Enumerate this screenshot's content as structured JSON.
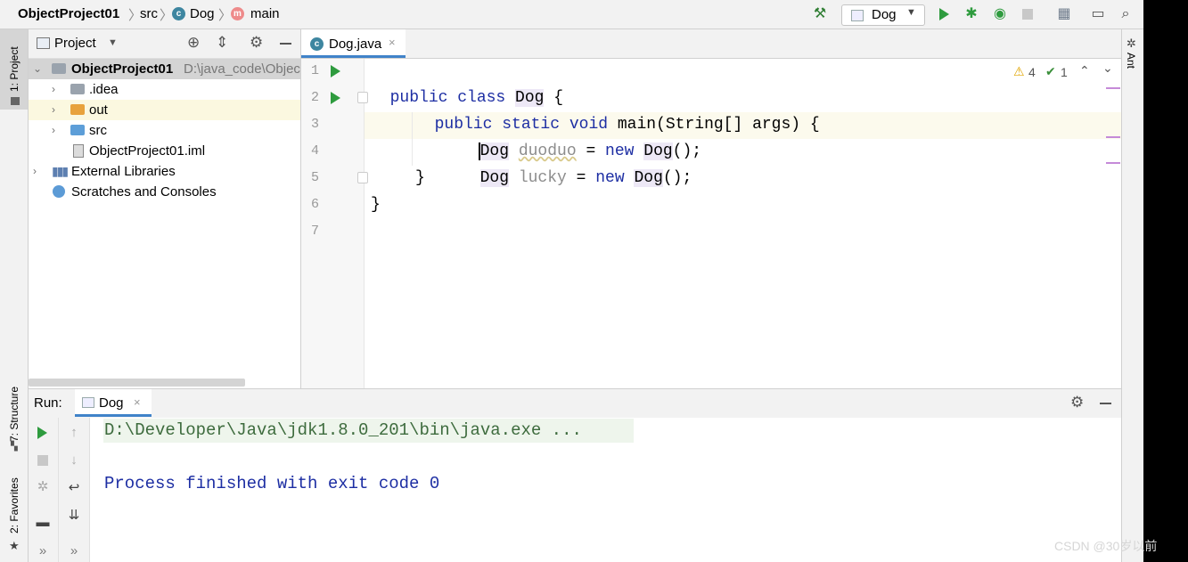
{
  "navbar": {
    "project": "ObjectProject01",
    "crumb_src": "src",
    "crumb_class": "Dog",
    "crumb_method": "main",
    "class_icon_letter": "c",
    "method_icon_letter": "m",
    "run_config": "Dog"
  },
  "left_strip": {
    "project_tab": "1: Project",
    "structure_tab": "7: Structure",
    "favorites_tab": "2: Favorites"
  },
  "right_strip": {
    "ant_tab": "Ant"
  },
  "project_panel": {
    "title": "Project",
    "root_name": "ObjectProject01",
    "root_path": "D:\\java_code\\Objec",
    "items": [
      {
        "label": ".idea"
      },
      {
        "label": "out"
      },
      {
        "label": "src"
      },
      {
        "label": "ObjectProject01.iml"
      },
      {
        "label": "External Libraries"
      },
      {
        "label": "Scratches and Consoles"
      }
    ]
  },
  "editor": {
    "tab_label": "Dog.java",
    "line_numbers": [
      "1",
      "2",
      "3",
      "4",
      "5",
      "6",
      "7"
    ],
    "warnings": "4",
    "checks": "1",
    "code": {
      "l1_kw": "public class ",
      "l1_cls": "Dog",
      "l1_rest": " {",
      "l2_kw": "public static void ",
      "l2_name": "main",
      "l2_rest": "(String[] args) {",
      "l3_type": "Dog",
      "l3_var": "duoduo",
      "l3_eq": " = ",
      "l3_new": "new ",
      "l3_cls": "Dog",
      "l3_rest": "();",
      "l4_type": "Dog",
      "l4_var": "lucky",
      "l4_eq": " = ",
      "l4_new": "new ",
      "l4_cls": "Dog",
      "l4_rest": "();",
      "l5": "}",
      "l6": "}"
    }
  },
  "run_panel": {
    "label": "Run:",
    "tab_label": "Dog",
    "console_line1": "D:\\Developer\\Java\\jdk1.8.0_201\\bin\\java.exe ...",
    "console_line2": "Process finished with exit code 0"
  },
  "watermark": "CSDN @30岁以前",
  "colors": {
    "keyword": "#1d2ea3",
    "run_green": "#2e9b3e",
    "accent_blue": "#4083c9",
    "console_cmd": "#3d6b3d",
    "console_text": "#1d2ea3"
  }
}
